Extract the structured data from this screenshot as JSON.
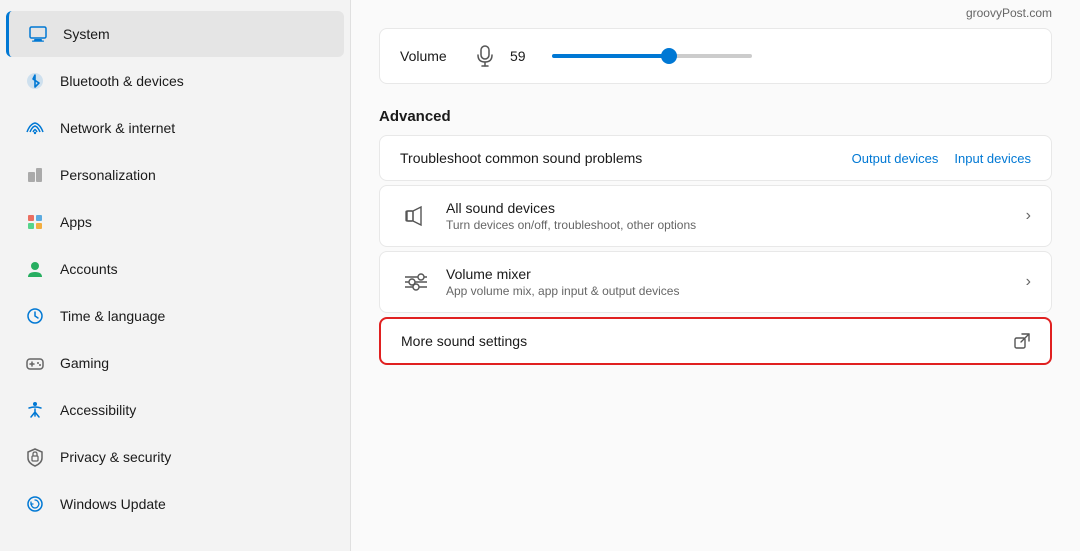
{
  "sidebar": {
    "items": [
      {
        "id": "system",
        "label": "System",
        "active": true
      },
      {
        "id": "bluetooth",
        "label": "Bluetooth & devices",
        "active": false
      },
      {
        "id": "network",
        "label": "Network & internet",
        "active": false
      },
      {
        "id": "personalization",
        "label": "Personalization",
        "active": false
      },
      {
        "id": "apps",
        "label": "Apps",
        "active": false
      },
      {
        "id": "accounts",
        "label": "Accounts",
        "active": false
      },
      {
        "id": "time",
        "label": "Time & language",
        "active": false
      },
      {
        "id": "gaming",
        "label": "Gaming",
        "active": false
      },
      {
        "id": "accessibility",
        "label": "Accessibility",
        "active": false
      },
      {
        "id": "privacy",
        "label": "Privacy & security",
        "active": false
      },
      {
        "id": "update",
        "label": "Windows Update",
        "active": false
      }
    ]
  },
  "main": {
    "watermark": "groovyPost.com",
    "volume_label": "Volume",
    "volume_value": "59",
    "advanced_title": "Advanced",
    "troubleshoot_label": "Troubleshoot common sound problems",
    "output_devices_label": "Output devices",
    "input_devices_label": "Input devices",
    "all_sound_devices_title": "All sound devices",
    "all_sound_devices_sub": "Turn devices on/off, troubleshoot, other options",
    "volume_mixer_title": "Volume mixer",
    "volume_mixer_sub": "App volume mix, app input & output devices",
    "more_sound_settings_label": "More sound settings"
  }
}
